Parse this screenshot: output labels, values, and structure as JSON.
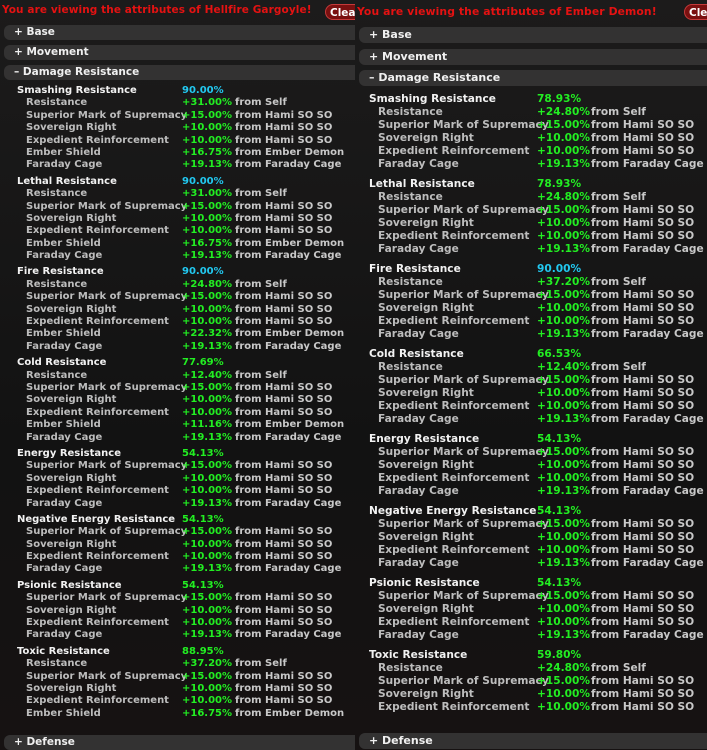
{
  "colors": {
    "capped": "#22c8f0",
    "normal": "#22ee22",
    "title": "#e51212"
  },
  "panels": [
    {
      "title": "You are viewing the attributes of Hellfire Gargoyle!",
      "clear_label": "Clear",
      "sections": {
        "base": "+ Base",
        "movement": "+ Movement",
        "damage_resistance": "– Damage Resistance",
        "defense": "+ Defense"
      },
      "categories": [
        {
          "name": "Smashing Resistance",
          "total": "90.00%",
          "capped": true,
          "rows": [
            {
              "name": "Resistance",
              "value": "+31.00%",
              "source": "from Self"
            },
            {
              "name": "Superior Mark of Supremacy",
              "value": "+15.00%",
              "source": "from Hami SO SO"
            },
            {
              "name": "Sovereign Right",
              "value": "+10.00%",
              "source": "from Hami SO SO"
            },
            {
              "name": "Expedient Reinforcement",
              "value": "+10.00%",
              "source": "from Hami SO SO"
            },
            {
              "name": "Ember Shield",
              "value": "+16.75%",
              "source": "from Ember Demon"
            },
            {
              "name": "Faraday Cage",
              "value": "+19.13%",
              "source": "from Faraday Cage"
            }
          ]
        },
        {
          "name": "Lethal Resistance",
          "total": "90.00%",
          "capped": true,
          "rows": [
            {
              "name": "Resistance",
              "value": "+31.00%",
              "source": "from Self"
            },
            {
              "name": "Superior Mark of Supremacy",
              "value": "+15.00%",
              "source": "from Hami SO SO"
            },
            {
              "name": "Sovereign Right",
              "value": "+10.00%",
              "source": "from Hami SO SO"
            },
            {
              "name": "Expedient Reinforcement",
              "value": "+10.00%",
              "source": "from Hami SO SO"
            },
            {
              "name": "Ember Shield",
              "value": "+16.75%",
              "source": "from Ember Demon"
            },
            {
              "name": "Faraday Cage",
              "value": "+19.13%",
              "source": "from Faraday Cage"
            }
          ]
        },
        {
          "name": "Fire Resistance",
          "total": "90.00%",
          "capped": true,
          "rows": [
            {
              "name": "Resistance",
              "value": "+24.80%",
              "source": "from Self"
            },
            {
              "name": "Superior Mark of Supremacy",
              "value": "+15.00%",
              "source": "from Hami SO SO"
            },
            {
              "name": "Sovereign Right",
              "value": "+10.00%",
              "source": "from Hami SO SO"
            },
            {
              "name": "Expedient Reinforcement",
              "value": "+10.00%",
              "source": "from Hami SO SO"
            },
            {
              "name": "Ember Shield",
              "value": "+22.32%",
              "source": "from Ember Demon"
            },
            {
              "name": "Faraday Cage",
              "value": "+19.13%",
              "source": "from Faraday Cage"
            }
          ]
        },
        {
          "name": "Cold Resistance",
          "total": "77.69%",
          "capped": false,
          "rows": [
            {
              "name": "Resistance",
              "value": "+12.40%",
              "source": "from Self"
            },
            {
              "name": "Superior Mark of Supremacy",
              "value": "+15.00%",
              "source": "from Hami SO SO"
            },
            {
              "name": "Sovereign Right",
              "value": "+10.00%",
              "source": "from Hami SO SO"
            },
            {
              "name": "Expedient Reinforcement",
              "value": "+10.00%",
              "source": "from Hami SO SO"
            },
            {
              "name": "Ember Shield",
              "value": "+11.16%",
              "source": "from Ember Demon"
            },
            {
              "name": "Faraday Cage",
              "value": "+19.13%",
              "source": "from Faraday Cage"
            }
          ]
        },
        {
          "name": "Energy Resistance",
          "total": "54.13%",
          "capped": false,
          "rows": [
            {
              "name": "Superior Mark of Supremacy",
              "value": "+15.00%",
              "source": "from Hami SO SO"
            },
            {
              "name": "Sovereign Right",
              "value": "+10.00%",
              "source": "from Hami SO SO"
            },
            {
              "name": "Expedient Reinforcement",
              "value": "+10.00%",
              "source": "from Hami SO SO"
            },
            {
              "name": "Faraday Cage",
              "value": "+19.13%",
              "source": "from Faraday Cage"
            }
          ]
        },
        {
          "name": "Negative Energy Resistance",
          "total": "54.13%",
          "capped": false,
          "rows": [
            {
              "name": "Superior Mark of Supremacy",
              "value": "+15.00%",
              "source": "from Hami SO SO"
            },
            {
              "name": "Sovereign Right",
              "value": "+10.00%",
              "source": "from Hami SO SO"
            },
            {
              "name": "Expedient Reinforcement",
              "value": "+10.00%",
              "source": "from Hami SO SO"
            },
            {
              "name": "Faraday Cage",
              "value": "+19.13%",
              "source": "from Faraday Cage"
            }
          ]
        },
        {
          "name": "Psionic Resistance",
          "total": "54.13%",
          "capped": false,
          "rows": [
            {
              "name": "Superior Mark of Supremacy",
              "value": "+15.00%",
              "source": "from Hami SO SO"
            },
            {
              "name": "Sovereign Right",
              "value": "+10.00%",
              "source": "from Hami SO SO"
            },
            {
              "name": "Expedient Reinforcement",
              "value": "+10.00%",
              "source": "from Hami SO SO"
            },
            {
              "name": "Faraday Cage",
              "value": "+19.13%",
              "source": "from Faraday Cage"
            }
          ]
        },
        {
          "name": "Toxic Resistance",
          "total": "88.95%",
          "capped": false,
          "rows": [
            {
              "name": "Resistance",
              "value": "+37.20%",
              "source": "from Self"
            },
            {
              "name": "Superior Mark of Supremacy",
              "value": "+15.00%",
              "source": "from Hami SO SO"
            },
            {
              "name": "Sovereign Right",
              "value": "+10.00%",
              "source": "from Hami SO SO"
            },
            {
              "name": "Expedient Reinforcement",
              "value": "+10.00%",
              "source": "from Hami SO SO"
            },
            {
              "name": "Ember Shield",
              "value": "+16.75%",
              "source": "from Ember Demon"
            }
          ]
        }
      ]
    },
    {
      "title": "You are viewing the attributes of Ember Demon!",
      "clear_label": "Clear",
      "sections": {
        "base": "+ Base",
        "movement": "+ Movement",
        "damage_resistance": "– Damage Resistance",
        "defense": "+ Defense"
      },
      "categories": [
        {
          "name": "Smashing Resistance",
          "total": "78.93%",
          "capped": false,
          "rows": [
            {
              "name": "Resistance",
              "value": "+24.80%",
              "source": "from Self"
            },
            {
              "name": "Superior Mark of Supremacy",
              "value": "+15.00%",
              "source": "from Hami SO SO"
            },
            {
              "name": "Sovereign Right",
              "value": "+10.00%",
              "source": "from Hami SO SO"
            },
            {
              "name": "Expedient Reinforcement",
              "value": "+10.00%",
              "source": "from Hami SO SO"
            },
            {
              "name": "Faraday Cage",
              "value": "+19.13%",
              "source": "from Faraday Cage"
            }
          ]
        },
        {
          "name": "Lethal Resistance",
          "total": "78.93%",
          "capped": false,
          "rows": [
            {
              "name": "Resistance",
              "value": "+24.80%",
              "source": "from Self"
            },
            {
              "name": "Superior Mark of Supremacy",
              "value": "+15.00%",
              "source": "from Hami SO SO"
            },
            {
              "name": "Sovereign Right",
              "value": "+10.00%",
              "source": "from Hami SO SO"
            },
            {
              "name": "Expedient Reinforcement",
              "value": "+10.00%",
              "source": "from Hami SO SO"
            },
            {
              "name": "Faraday Cage",
              "value": "+19.13%",
              "source": "from Faraday Cage"
            }
          ]
        },
        {
          "name": "Fire Resistance",
          "total": "90.00%",
          "capped": true,
          "rows": [
            {
              "name": "Resistance",
              "value": "+37.20%",
              "source": "from Self"
            },
            {
              "name": "Superior Mark of Supremacy",
              "value": "+15.00%",
              "source": "from Hami SO SO"
            },
            {
              "name": "Sovereign Right",
              "value": "+10.00%",
              "source": "from Hami SO SO"
            },
            {
              "name": "Expedient Reinforcement",
              "value": "+10.00%",
              "source": "from Hami SO SO"
            },
            {
              "name": "Faraday Cage",
              "value": "+19.13%",
              "source": "from Faraday Cage"
            }
          ]
        },
        {
          "name": "Cold Resistance",
          "total": "66.53%",
          "capped": false,
          "rows": [
            {
              "name": "Resistance",
              "value": "+12.40%",
              "source": "from Self"
            },
            {
              "name": "Superior Mark of Supremacy",
              "value": "+15.00%",
              "source": "from Hami SO SO"
            },
            {
              "name": "Sovereign Right",
              "value": "+10.00%",
              "source": "from Hami SO SO"
            },
            {
              "name": "Expedient Reinforcement",
              "value": "+10.00%",
              "source": "from Hami SO SO"
            },
            {
              "name": "Faraday Cage",
              "value": "+19.13%",
              "source": "from Faraday Cage"
            }
          ]
        },
        {
          "name": "Energy Resistance",
          "total": "54.13%",
          "capped": false,
          "rows": [
            {
              "name": "Superior Mark of Supremacy",
              "value": "+15.00%",
              "source": "from Hami SO SO"
            },
            {
              "name": "Sovereign Right",
              "value": "+10.00%",
              "source": "from Hami SO SO"
            },
            {
              "name": "Expedient Reinforcement",
              "value": "+10.00%",
              "source": "from Hami SO SO"
            },
            {
              "name": "Faraday Cage",
              "value": "+19.13%",
              "source": "from Faraday Cage"
            }
          ]
        },
        {
          "name": "Negative Energy Resistance",
          "total": "54.13%",
          "capped": false,
          "rows": [
            {
              "name": "Superior Mark of Supremacy",
              "value": "+15.00%",
              "source": "from Hami SO SO"
            },
            {
              "name": "Sovereign Right",
              "value": "+10.00%",
              "source": "from Hami SO SO"
            },
            {
              "name": "Expedient Reinforcement",
              "value": "+10.00%",
              "source": "from Hami SO SO"
            },
            {
              "name": "Faraday Cage",
              "value": "+19.13%",
              "source": "from Faraday Cage"
            }
          ]
        },
        {
          "name": "Psionic Resistance",
          "total": "54.13%",
          "capped": false,
          "rows": [
            {
              "name": "Superior Mark of Supremacy",
              "value": "+15.00%",
              "source": "from Hami SO SO"
            },
            {
              "name": "Sovereign Right",
              "value": "+10.00%",
              "source": "from Hami SO SO"
            },
            {
              "name": "Expedient Reinforcement",
              "value": "+10.00%",
              "source": "from Hami SO SO"
            },
            {
              "name": "Faraday Cage",
              "value": "+19.13%",
              "source": "from Faraday Cage"
            }
          ]
        },
        {
          "name": "Toxic Resistance",
          "total": "59.80%",
          "capped": false,
          "rows": [
            {
              "name": "Resistance",
              "value": "+24.80%",
              "source": "from Self"
            },
            {
              "name": "Superior Mark of Supremacy",
              "value": "+15.00%",
              "source": "from Hami SO SO"
            },
            {
              "name": "Sovereign Right",
              "value": "+10.00%",
              "source": "from Hami SO SO"
            },
            {
              "name": "Expedient Reinforcement",
              "value": "+10.00%",
              "source": "from Hami SO SO"
            }
          ]
        }
      ]
    }
  ]
}
